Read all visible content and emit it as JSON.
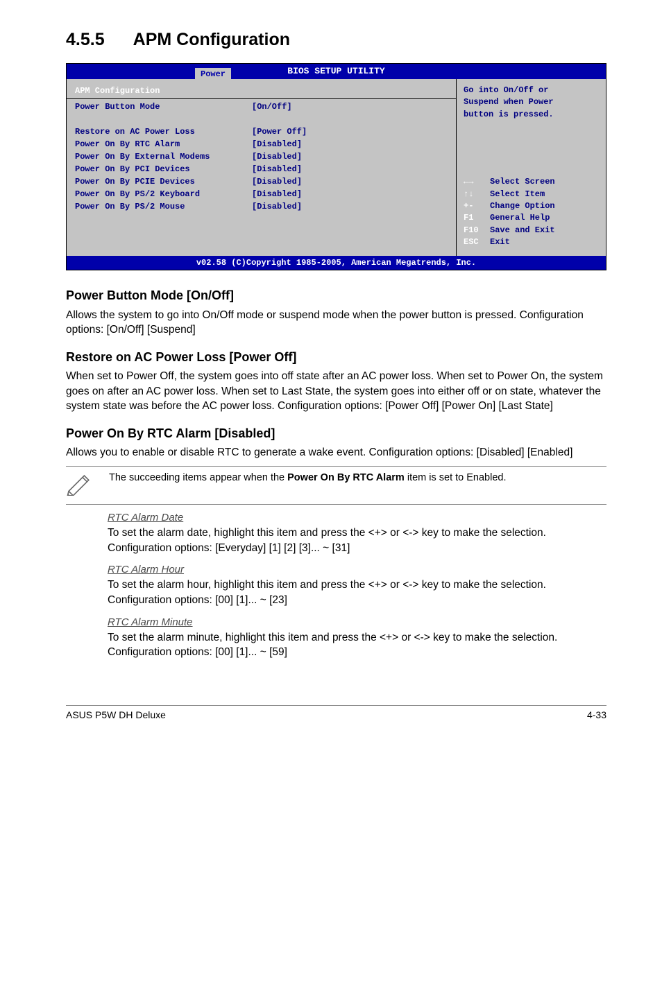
{
  "section": {
    "number": "4.5.5",
    "title": "APM Configuration"
  },
  "bios": {
    "title_main": "BIOS SETUP UTILITY",
    "title_tab": "Power",
    "left_header": "APM Configuration",
    "rows": [
      {
        "label": "Power Button Mode",
        "value": "[On/Off]"
      },
      {
        "label": " ",
        "value": " "
      },
      {
        "label": "Restore on AC Power Loss",
        "value": "[Power Off]"
      },
      {
        "label": "Power On By RTC Alarm",
        "value": "[Disabled]"
      },
      {
        "label": "Power On By External Modems",
        "value": "[Disabled]"
      },
      {
        "label": "Power On By PCI Devices",
        "value": "[Disabled]"
      },
      {
        "label": "Power On By PCIE Devices",
        "value": "[Disabled]"
      },
      {
        "label": "Power On By PS/2 Keyboard",
        "value": "[Disabled]"
      },
      {
        "label": "Power On By PS/2 Mouse",
        "value": "[Disabled]"
      }
    ],
    "right_header_line1": "Go into On/Off or",
    "right_header_line2": "Suspend when Power",
    "right_header_line3": "button is pressed.",
    "help": [
      {
        "k": "←→",
        "v": "Select Screen"
      },
      {
        "k": "↑↓",
        "v": "Select Item"
      },
      {
        "k": "+-",
        "v": "Change Option"
      },
      {
        "k": "F1",
        "v": "General Help"
      },
      {
        "k": "F10",
        "v": "Save and Exit"
      },
      {
        "k": "ESC",
        "v": "Exit"
      }
    ],
    "footer": "v02.58 (C)Copyright 1985-2005, American Megatrends, Inc."
  },
  "blocks": {
    "pbm_title": "Power Button Mode [On/Off]",
    "pbm_text": "Allows the system to go into On/Off mode or suspend mode when the power button is pressed. Configuration options: [On/Off] [Suspend]",
    "rac_title": "Restore on AC Power Loss [Power Off]",
    "rac_text": "When set to Power Off, the system goes into off state after an AC power loss. When set to Power On, the system goes on after an AC power loss. When set to Last State, the system goes into either off or on state, whatever the system state was before the AC power loss. Configuration options: [Power Off] [Power On] [Last State]",
    "rtc_title": "Power On By RTC Alarm [Disabled]",
    "rtc_text": "Allows you to enable or disable RTC to generate a wake event. Configuration options: [Disabled] [Enabled]",
    "note_text_1": "The succeeding items appear when the ",
    "note_bold": "Power On By RTC Alarm",
    "note_text_2": " item is set to Enabled.",
    "rtc_date_title": "RTC Alarm Date ",
    "rtc_date_text": "To set the alarm date, highlight this item and press the <+> or <-> key to make the selection. Configuration options: [Everyday] [1] [2] [3]... ~ [31]",
    "rtc_hour_title": "RTC Alarm Hour",
    "rtc_hour_text": "To set the alarm hour, highlight this item and press the <+> or <-> key to make the selection. Configuration options: [00] [1]... ~ [23]",
    "rtc_min_title": "RTC Alarm Minute",
    "rtc_min_text": "To set the alarm minute, highlight this item and press the <+> or <-> key to make the selection. Configuration options: [00] [1]... ~ [59]"
  },
  "footer": {
    "left": "ASUS P5W DH Deluxe",
    "right": "4-33"
  }
}
